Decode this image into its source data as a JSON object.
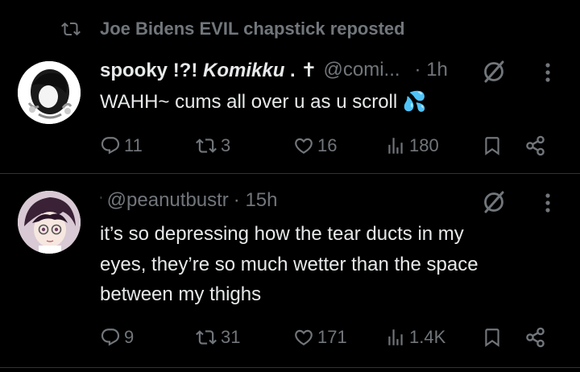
{
  "repost": {
    "text": "Joe Bidens EVIL chapstick reposted"
  },
  "tweets": [
    {
      "name_prefix": "spooky !?! ",
      "name_italic": "Komikku",
      "name_suffix": " . ✝",
      "handle": "@comi...",
      "time": "· 1h",
      "text": "WAHH~ cums all over u as u scroll 💦",
      "replies": "11",
      "reposts": "3",
      "likes": "16",
      "views": "180"
    },
    {
      "name_prefix": "",
      "handle": "@peanutbustr",
      "time": "· 15h",
      "text_lines": [
        "it’s so depressing how the tear ducts in my",
        "eyes, they’re so much wetter than the space",
        "between my thighs"
      ],
      "replies": "9",
      "reposts": "31",
      "likes": "171",
      "views": "1.4K"
    }
  ],
  "icons": {
    "repost": "repost-icon",
    "reply": "reply-icon",
    "like": "heart-icon",
    "views": "views-icon",
    "bookmark": "bookmark-icon",
    "share": "share-icon",
    "grok": "grok-icon",
    "more": "more-icon"
  },
  "colors": {
    "background": "#000000",
    "text": "#e7e9ea",
    "muted": "#71767b",
    "divider": "#2f3336",
    "splash": "#1d9bf0"
  }
}
